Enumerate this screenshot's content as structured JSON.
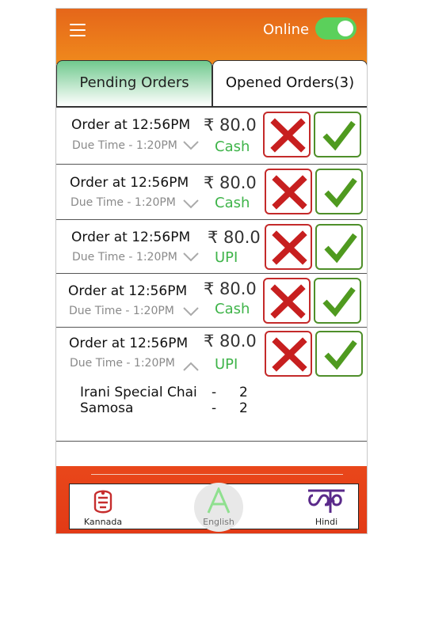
{
  "header": {
    "online_label": "Online",
    "online_enabled": true
  },
  "tabs": {
    "pending": "Pending Orders",
    "opened": "Opened Orders(3)"
  },
  "orders": [
    {
      "title": "Order at 12:56PM",
      "due": "Due Time - 1:20PM",
      "price": "₹ 80.0",
      "payment": "Cash",
      "expanded": false
    },
    {
      "title": "Order at 12:56PM",
      "due": "Due Time - 1:20PM",
      "price": "₹ 80.0",
      "payment": "Cash",
      "expanded": false
    },
    {
      "title": "Order at 12:56PM",
      "due": "Due Time - 1:20PM",
      "price": "₹ 80.0",
      "payment": "UPI",
      "expanded": false
    },
    {
      "title": "Order at 12:56PM",
      "due": "Due Time - 1:20PM",
      "price": "₹ 80.0",
      "payment": "Cash",
      "expanded": false
    },
    {
      "title": "Order at 12:56PM",
      "due": "Due Time - 1:20PM",
      "price": "₹ 80.0",
      "payment": "UPI",
      "expanded": true,
      "items": [
        {
          "name": "Irani Special Chai",
          "sep": "-",
          "qty": "2"
        },
        {
          "name": "Samosa",
          "sep": "-",
          "qty": "2"
        }
      ]
    }
  ],
  "footer": {
    "languages": [
      {
        "label": "Kannada",
        "icon": "kannada-glyph-icon"
      },
      {
        "label": "English",
        "icon": "letter-a-icon"
      },
      {
        "label": "Hindi",
        "icon": "hindi-glyph-icon"
      }
    ]
  },
  "colors": {
    "header": "#e5661a",
    "footer": "#e23a16",
    "accent_green": "#3fb44a",
    "reject_red": "#c42a2a",
    "accept_green": "#4f8f2a"
  }
}
